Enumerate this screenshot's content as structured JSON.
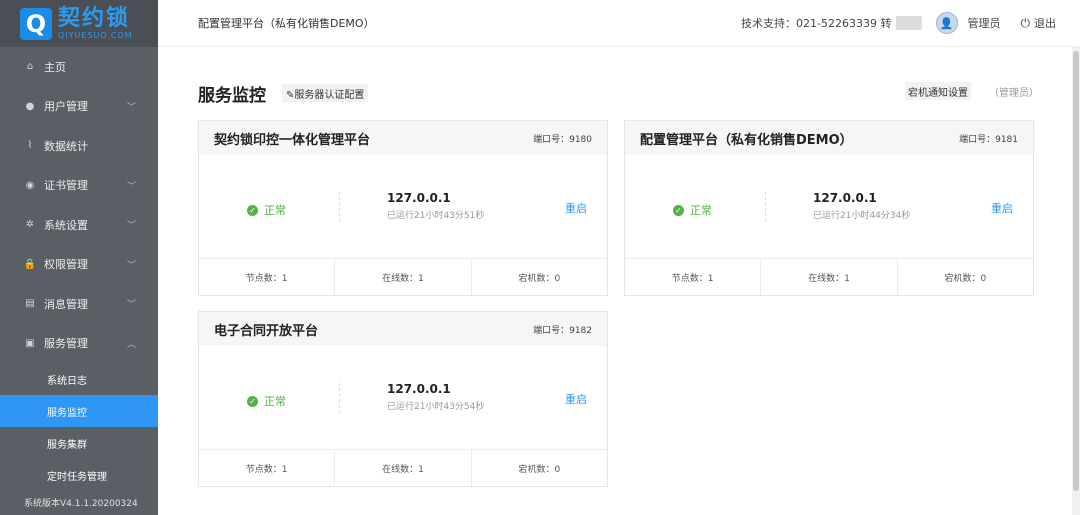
{
  "brand": {
    "mark": "Q",
    "name": "契约锁",
    "sub": "QIYUESUO.COM"
  },
  "sidebar": {
    "items": [
      {
        "label": "主页",
        "icon": "⌂",
        "chevron": false
      },
      {
        "label": "用户管理",
        "icon": "●",
        "chevron": true
      },
      {
        "label": "数据统计",
        "icon": "⌇",
        "chevron": false
      },
      {
        "label": "证书管理",
        "icon": "◉",
        "chevron": true
      },
      {
        "label": "系统设置",
        "icon": "✲",
        "chevron": true
      },
      {
        "label": "权限管理",
        "icon": "🔒",
        "chevron": true
      },
      {
        "label": "消息管理",
        "icon": "▤",
        "chevron": true
      },
      {
        "label": "服务管理",
        "icon": "▣",
        "chevron": true,
        "expanded": true
      }
    ],
    "subitems": [
      {
        "label": "系统日志",
        "active": false
      },
      {
        "label": "服务监控",
        "active": true
      },
      {
        "label": "服务集群",
        "active": false
      },
      {
        "label": "定时任务管理",
        "active": false
      }
    ],
    "version": "系统版本V4.1.1.20200324"
  },
  "header": {
    "title": "配置管理平台（私有化销售DEMO）",
    "support": "技术支持：021-52263339 转",
    "admin": "管理员",
    "logout": "退出"
  },
  "page": {
    "title": "服务监控",
    "config_btn": "✎服务器认证配置",
    "notify_btn": "宕机通知设置",
    "notify_role": "（管理员）"
  },
  "cards": [
    {
      "title": "契约锁印控一体化管理平台",
      "port": "端口号：9180",
      "status": "正常",
      "ip": "127.0.0.1",
      "uptime": "已运行21小时43分51秒",
      "restart": "重启",
      "nodes": "节点数：1",
      "online": "在线数：1",
      "down": "宕机数：0"
    },
    {
      "title": "配置管理平台（私有化销售DEMO）",
      "port": "端口号：9181",
      "status": "正常",
      "ip": "127.0.0.1",
      "uptime": "已运行21小时44分34秒",
      "restart": "重启",
      "nodes": "节点数：1",
      "online": "在线数：1",
      "down": "宕机数：0"
    },
    {
      "title": "电子合同开放平台",
      "port": "端口号：9182",
      "status": "正常",
      "ip": "127.0.0.1",
      "uptime": "已运行21小时43分54秒",
      "restart": "重启",
      "nodes": "节点数：1",
      "online": "在线数：1",
      "down": "宕机数：0"
    }
  ],
  "colors": {
    "accent": "#2d97f3",
    "ok": "#52b244",
    "sidebar": "#5a5f66"
  }
}
